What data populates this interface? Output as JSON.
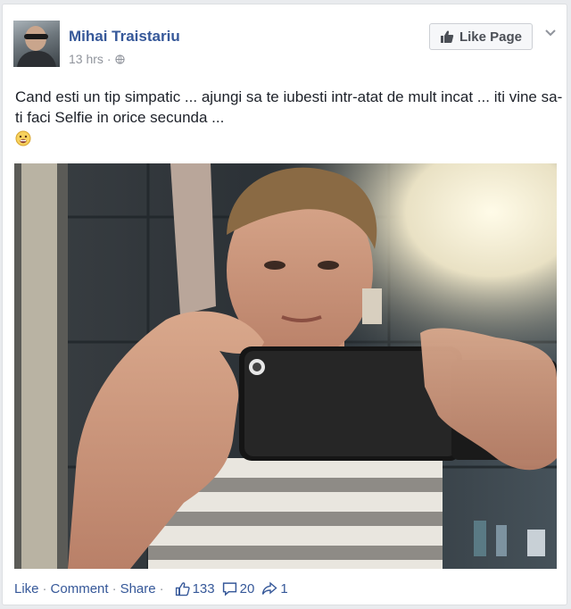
{
  "post": {
    "author": "Mihai Traistariu",
    "time": "13 hrs",
    "separator": "·",
    "text": "Cand esti un tip simpatic ... ajungi sa te iubesti intr-atat de mult incat ... iti vine sa-ti faci Selfie in orice secunda ...",
    "emoji": "drooling-face-emoji",
    "photo_description_icon": "selfie-photo"
  },
  "header": {
    "like_page_label": "Like Page",
    "like_icon": "thumbs-up-icon",
    "menu_icon": "chevron-down-icon"
  },
  "actions": {
    "like": "Like",
    "comment": "Comment",
    "share": "Share",
    "dot": "·",
    "likes_count": "133",
    "comments_count": "20",
    "shares_count": "1"
  },
  "colors": {
    "link": "#365899",
    "text": "#1d2129",
    "muted": "#90949c",
    "background": "#e9ebee"
  }
}
